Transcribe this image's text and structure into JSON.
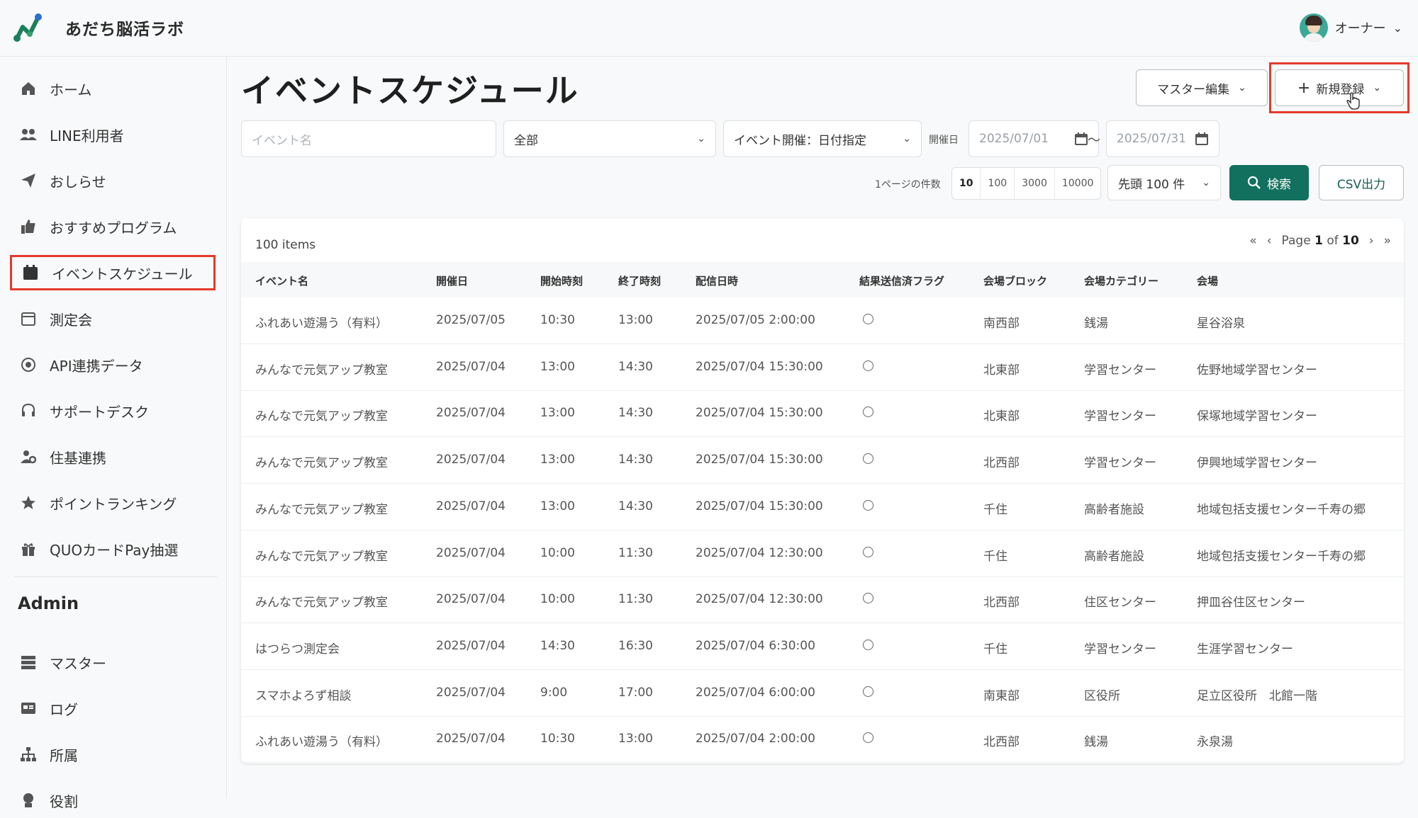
{
  "header": {
    "app_title": "あだち脳活ラボ",
    "user_name": "オーナー"
  },
  "sidebar": {
    "items": [
      {
        "label": "ホーム",
        "icon": "home-icon"
      },
      {
        "label": "LINE利用者",
        "icon": "users-icon"
      },
      {
        "label": "おしらせ",
        "icon": "paper-plane-icon"
      },
      {
        "label": "おすすめプログラム",
        "icon": "thumbs-up-icon"
      },
      {
        "label": "イベントスケジュール",
        "icon": "calendar-icon",
        "active": true
      },
      {
        "label": "測定会",
        "icon": "calendar-outline-icon"
      },
      {
        "label": "API連携データ",
        "icon": "sync-icon"
      },
      {
        "label": "サポートデスク",
        "icon": "headset-icon"
      },
      {
        "label": "住基連携",
        "icon": "user-gear-icon"
      },
      {
        "label": "ポイントランキング",
        "icon": "star-icon"
      },
      {
        "label": "QUOカードPay抽選",
        "icon": "gift-icon"
      }
    ],
    "admin_heading": "Admin",
    "admin_items": [
      {
        "label": "マスター",
        "icon": "database-icon"
      },
      {
        "label": "ログ",
        "icon": "log-icon"
      },
      {
        "label": "所属",
        "icon": "org-chart-icon"
      },
      {
        "label": "役割",
        "icon": "badge-icon"
      }
    ]
  },
  "main": {
    "title": "イベントスケジュール",
    "master_edit_label": "マスター編集",
    "new_label": "新規登録",
    "filters": {
      "event_name_placeholder": "イベント名",
      "category_value": "全部",
      "date_mode_value": "イベント開催：日付指定",
      "date_label": "開催日",
      "date_from": "2025/07/01",
      "tilde": "〜",
      "date_to": "2025/07/31"
    },
    "per_page_label": "1ページの件数",
    "per_page_options": [
      "10",
      "100",
      "3000",
      "10000"
    ],
    "per_page_selected": "10",
    "range_value": "先頭 100 件",
    "search_label": "検索",
    "csv_label": "CSV出力",
    "items_count": "100 items",
    "pager": {
      "prefix": "Page",
      "current": "1",
      "of": "of",
      "total": "10"
    },
    "columns": [
      "イベント名",
      "開催日",
      "開始時刻",
      "終了時刻",
      "配信日時",
      "結果送信済フラグ",
      "会場ブロック",
      "会場カテゴリー",
      "会場"
    ],
    "rows": [
      [
        "ふれあい遊湯う（有料）",
        "2025/07/05",
        "10:30",
        "13:00",
        "2025/07/05 2:00:00",
        "南西部",
        "銭湯",
        "星谷浴泉"
      ],
      [
        "みんなで元気アップ教室",
        "2025/07/04",
        "13:00",
        "14:30",
        "2025/07/04 15:30:00",
        "北東部",
        "学習センター",
        "佐野地域学習センター"
      ],
      [
        "みんなで元気アップ教室",
        "2025/07/04",
        "13:00",
        "14:30",
        "2025/07/04 15:30:00",
        "北東部",
        "学習センター",
        "保塚地域学習センター"
      ],
      [
        "みんなで元気アップ教室",
        "2025/07/04",
        "13:00",
        "14:30",
        "2025/07/04 15:30:00",
        "北西部",
        "学習センター",
        "伊興地域学習センター"
      ],
      [
        "みんなで元気アップ教室",
        "2025/07/04",
        "13:00",
        "14:30",
        "2025/07/04 15:30:00",
        "千住",
        "高齢者施設",
        "地域包括支援センター千寿の郷"
      ],
      [
        "みんなで元気アップ教室",
        "2025/07/04",
        "10:00",
        "11:30",
        "2025/07/04 12:30:00",
        "千住",
        "高齢者施設",
        "地域包括支援センター千寿の郷"
      ],
      [
        "みんなで元気アップ教室",
        "2025/07/04",
        "10:00",
        "11:30",
        "2025/07/04 12:30:00",
        "北西部",
        "住区センター",
        "押皿谷住区センター"
      ],
      [
        "はつらつ測定会",
        "2025/07/04",
        "14:30",
        "16:30",
        "2025/07/04 6:30:00",
        "千住",
        "学習センター",
        "生涯学習センター"
      ],
      [
        "スマホよろず相談",
        "2025/07/04",
        "9:00",
        "17:00",
        "2025/07/04 6:00:00",
        "南東部",
        "区役所",
        "足立区役所　北館一階"
      ],
      [
        "ふれあい遊湯う（有料）",
        "2025/07/04",
        "10:30",
        "13:00",
        "2025/07/04 2:00:00",
        "北西部",
        "銭湯",
        "永泉湯"
      ]
    ]
  },
  "colors": {
    "accent": "#12705e",
    "highlight": "#e53a2c"
  }
}
